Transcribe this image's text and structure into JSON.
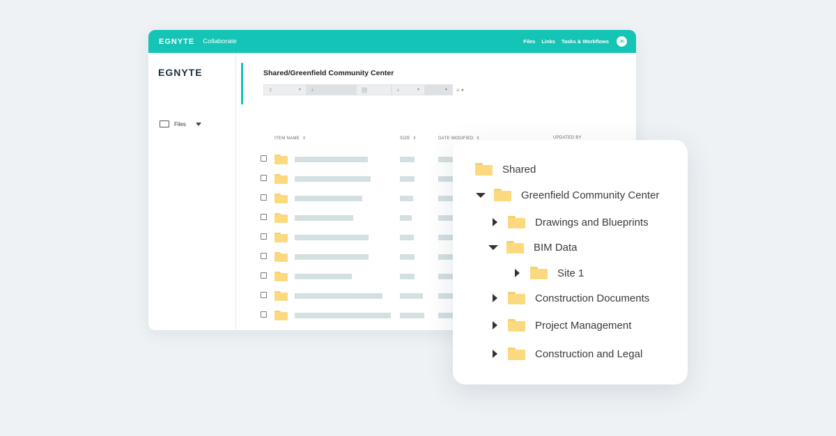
{
  "topbar": {
    "brand": "EGNYTE",
    "app": "Collaborate",
    "nav": [
      "Files",
      "Links",
      "Tasks & Workflows"
    ],
    "avatar_initials": "JD",
    "accent_color": "#14c4b4"
  },
  "sidebar": {
    "logo": "EGNYTE",
    "files_label": "Files"
  },
  "main": {
    "path": "Shared/Greenfield Community Center",
    "columns": [
      "ITEM NAME",
      "SIZE",
      "DATE MODIFIED",
      "UPDATED BY"
    ]
  },
  "tree": {
    "nodes": [
      {
        "label": "Shared",
        "expander": "none"
      },
      {
        "label": "Greenfield Community Center",
        "expander": "expanded"
      },
      {
        "label": "Drawings and Blueprints",
        "expander": "collapsed"
      },
      {
        "label": "BIM Data",
        "expander": "expanded"
      },
      {
        "label": "Site 1",
        "expander": "collapsed"
      },
      {
        "label": "Construction Documents",
        "expander": "collapsed"
      },
      {
        "label": "Project Management",
        "expander": "collapsed"
      },
      {
        "label": "Construction and Legal",
        "expander": "collapsed"
      }
    ]
  }
}
